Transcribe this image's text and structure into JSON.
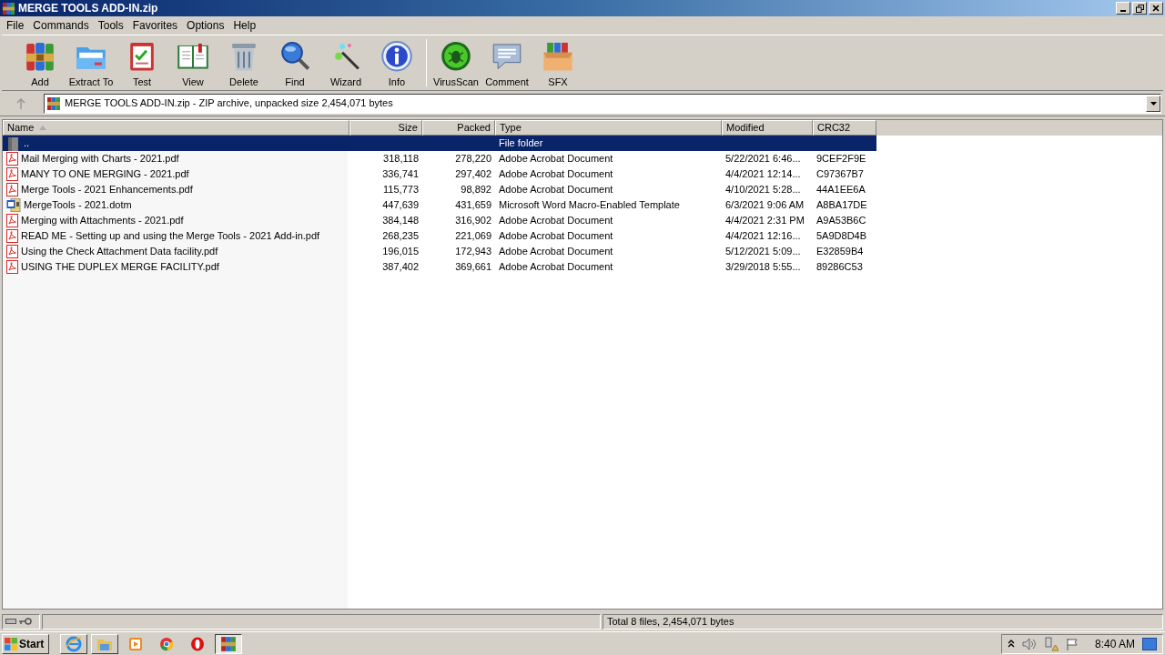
{
  "window": {
    "title": "MERGE TOOLS ADD-IN.zip"
  },
  "menu": [
    "File",
    "Commands",
    "Tools",
    "Favorites",
    "Options",
    "Help"
  ],
  "toolbar": [
    {
      "kind": "add",
      "label": "Add"
    },
    {
      "kind": "extract",
      "label": "Extract To"
    },
    {
      "kind": "test",
      "label": "Test"
    },
    {
      "kind": "view",
      "label": "View"
    },
    {
      "kind": "delete",
      "label": "Delete"
    },
    {
      "kind": "find",
      "label": "Find"
    },
    {
      "kind": "wizard",
      "label": "Wizard"
    },
    {
      "kind": "info",
      "label": "Info"
    },
    {
      "kind": "virus",
      "label": "VirusScan"
    },
    {
      "kind": "comment",
      "label": "Comment"
    },
    {
      "kind": "sfx",
      "label": "SFX"
    }
  ],
  "address": {
    "value": "MERGE TOOLS ADD-IN.zip - ZIP archive, unpacked size 2,454,071 bytes"
  },
  "table": {
    "columns": [
      "Name",
      "Size",
      "Packed",
      "Type",
      "Modified",
      "CRC32"
    ],
    "rows": [
      {
        "kind": "folder",
        "selected": true,
        "cells": [
          "..",
          "",
          "",
          "File folder",
          "",
          ""
        ]
      },
      {
        "kind": "pdf",
        "selected": false,
        "cells": [
          "Mail Merging with Charts - 2021.pdf",
          "318,118",
          "278,220",
          "Adobe Acrobat Document",
          "5/22/2021 6:46...",
          "9CEF2F9E"
        ]
      },
      {
        "kind": "pdf",
        "selected": false,
        "cells": [
          "MANY TO ONE MERGING - 2021.pdf",
          "336,741",
          "297,402",
          "Adobe Acrobat Document",
          "4/4/2021 12:14...",
          "C97367B7"
        ]
      },
      {
        "kind": "pdf",
        "selected": false,
        "cells": [
          "Merge Tools - 2021 Enhancements.pdf",
          "115,773",
          "98,892",
          "Adobe Acrobat Document",
          "4/10/2021 5:28...",
          "44A1EE6A"
        ]
      },
      {
        "kind": "word",
        "selected": false,
        "cells": [
          "MergeTools - 2021.dotm",
          "447,639",
          "431,659",
          "Microsoft Word Macro-Enabled Template",
          "6/3/2021 9:06 AM",
          "A8BA17DE"
        ]
      },
      {
        "kind": "pdf",
        "selected": false,
        "cells": [
          "Merging with Attachments - 2021.pdf",
          "384,148",
          "316,902",
          "Adobe Acrobat Document",
          "4/4/2021 2:31 PM",
          "A9A53B6C"
        ]
      },
      {
        "kind": "pdf",
        "selected": false,
        "cells": [
          "READ ME - Setting up and using the Merge Tools - 2021 Add-in.pdf",
          "268,235",
          "221,069",
          "Adobe Acrobat Document",
          "4/4/2021 12:16...",
          "5A9D8D4B"
        ]
      },
      {
        "kind": "pdf",
        "selected": false,
        "cells": [
          "Using the Check Attachment Data facility.pdf",
          "196,015",
          "172,943",
          "Adobe Acrobat Document",
          "5/12/2021 5:09...",
          "E32859B4"
        ]
      },
      {
        "kind": "pdf",
        "selected": false,
        "cells": [
          "USING THE DUPLEX MERGE FACILITY.pdf",
          "387,402",
          "369,661",
          "Adobe Acrobat Document",
          "3/29/2018 5:55...",
          "89286C53"
        ]
      }
    ]
  },
  "status_bar": {
    "text": "Total 8 files, 2,454,071 bytes"
  },
  "taskbar": {
    "start": "Start",
    "items": [
      {
        "kind": "ie",
        "selected": false
      },
      {
        "kind": "explorer",
        "selected": false
      },
      {
        "kind": "media",
        "selected": false
      },
      {
        "kind": "chrome",
        "selected": false
      },
      {
        "kind": "opera",
        "selected": false
      },
      {
        "kind": "winrar",
        "selected": true
      }
    ],
    "clock": "8:40 AM"
  }
}
